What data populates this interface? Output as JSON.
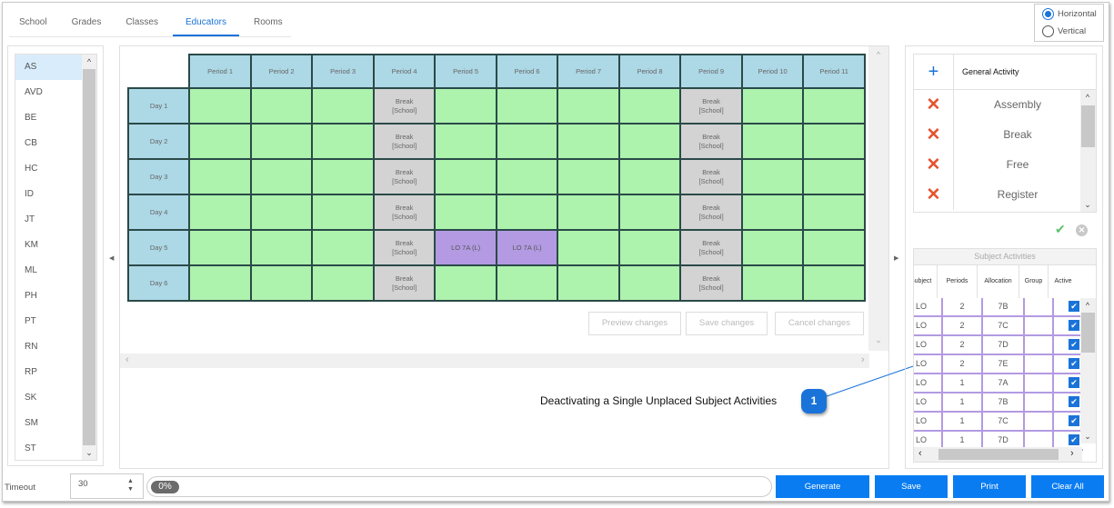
{
  "tabs": [
    {
      "label": "School",
      "active": false
    },
    {
      "label": "Grades",
      "active": false
    },
    {
      "label": "Classes",
      "active": false
    },
    {
      "label": "Educators",
      "active": true
    },
    {
      "label": "Rooms",
      "active": false
    }
  ],
  "orientation": {
    "options": [
      "Horizontal",
      "Vertical"
    ],
    "selected": "Horizontal"
  },
  "educators": {
    "items": [
      "AS",
      "AVD",
      "BE",
      "CB",
      "HC",
      "ID",
      "JT",
      "KM",
      "ML",
      "PH",
      "PT",
      "RN",
      "RP",
      "SK",
      "SM",
      "ST"
    ],
    "selected": "AS"
  },
  "timetable": {
    "periods": [
      "Period 1",
      "Period 2",
      "Period 3",
      "Period 4",
      "Period 5",
      "Period 6",
      "Period 7",
      "Period 8",
      "Period 9",
      "Period 10",
      "Period 11"
    ],
    "days": [
      {
        "label": "Day 1",
        "cells": [
          "",
          "",
          "",
          "Break\n[School]",
          "",
          "",
          "",
          "",
          "Break\n[School]",
          "",
          ""
        ]
      },
      {
        "label": "Day 2",
        "cells": [
          "",
          "",
          "",
          "Break\n[School]",
          "",
          "",
          "",
          "",
          "Break\n[School]",
          "",
          ""
        ]
      },
      {
        "label": "Day 3",
        "cells": [
          "",
          "",
          "",
          "Break\n[School]",
          "",
          "",
          "",
          "",
          "Break\n[School]",
          "",
          ""
        ]
      },
      {
        "label": "Day 4",
        "cells": [
          "",
          "",
          "",
          "Break\n[School]",
          "",
          "",
          "",
          "",
          "Break\n[School]",
          "",
          ""
        ]
      },
      {
        "label": "Day 5",
        "cells": [
          "",
          "",
          "",
          "Break\n[School]",
          "LO 7A (L)",
          "LO 7A (L)",
          "",
          "",
          "Break\n[School]",
          "",
          ""
        ]
      },
      {
        "label": "Day 6",
        "cells": [
          "",
          "",
          "",
          "Break\n[School]",
          "",
          "",
          "",
          "",
          "Break\n[School]",
          "",
          ""
        ]
      }
    ],
    "buttons": {
      "preview": "Preview changes",
      "save": "Save changes",
      "cancel": "Cancel changes"
    }
  },
  "annotation": {
    "text": "Deactivating a Single Unplaced Subject Activities",
    "badge": "1"
  },
  "general_activity": {
    "title": "General Activity",
    "items": [
      "Assembly",
      "Break",
      "Free",
      "Register"
    ]
  },
  "subject_activities": {
    "title": "Subject Activities",
    "columns": [
      "Subject",
      "Periods",
      "Allocation",
      "Group",
      "Active"
    ],
    "rows": [
      {
        "subject": "LO",
        "periods": "2",
        "allocation": "7B",
        "group": "",
        "active": true
      },
      {
        "subject": "LO",
        "periods": "2",
        "allocation": "7C",
        "group": "",
        "active": true
      },
      {
        "subject": "LO",
        "periods": "2",
        "allocation": "7D",
        "group": "",
        "active": true
      },
      {
        "subject": "LO",
        "periods": "2",
        "allocation": "7E",
        "group": "",
        "active": true
      },
      {
        "subject": "LO",
        "periods": "1",
        "allocation": "7A",
        "group": "",
        "active": true
      },
      {
        "subject": "LO",
        "periods": "1",
        "allocation": "7B",
        "group": "",
        "active": true
      },
      {
        "subject": "LO",
        "periods": "1",
        "allocation": "7C",
        "group": "",
        "active": true
      },
      {
        "subject": "LO",
        "periods": "1",
        "allocation": "7D",
        "group": "",
        "active": true
      }
    ]
  },
  "bottom": {
    "timeout_label": "Timeout",
    "timeout_value": "30",
    "progress_text": "0%",
    "progress": 0,
    "buttons": {
      "generate": "Generate",
      "save": "Save",
      "print": "Print",
      "clear": "Clear All"
    }
  },
  "colors": {
    "accent": "#1a73d9",
    "header_cell": "#add8e6",
    "free_cell": "#adf2ad",
    "break_cell": "#d3d3d3",
    "lesson_cell": "#b39ae2",
    "delete": "#e5532f",
    "confirm": "#5cc26a"
  }
}
